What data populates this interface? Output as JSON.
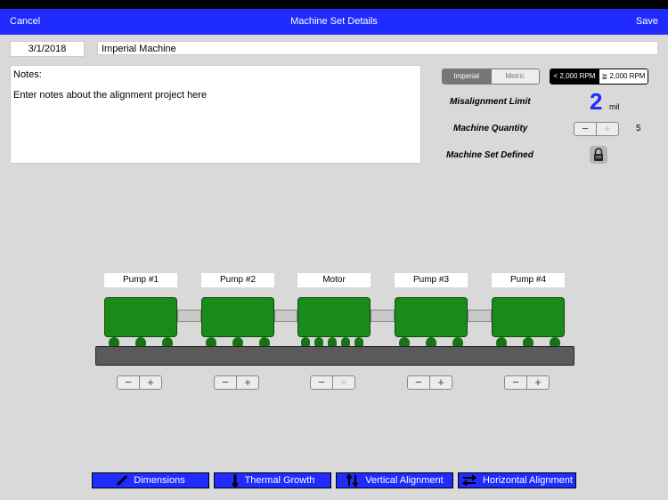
{
  "nav": {
    "cancel": "Cancel",
    "title": "Machine Set Details",
    "save": "Save"
  },
  "form": {
    "date": "3/1/2018",
    "name": "Imperial Machine",
    "notes_label": "Notes:",
    "notes_text": "Enter notes about the alignment project here"
  },
  "units": {
    "imperial": "Imperial",
    "metric": "Metric",
    "selected": "Imperial"
  },
  "rpm": {
    "low": "< 2,000 RPM",
    "high": "≧ 2,000 RPM",
    "selected": "< 2,000 RPM"
  },
  "settings": {
    "misalignment_label": "Misalignment Limit",
    "misalignment_value": "2",
    "misalignment_unit": "mil",
    "quantity_label": "Machine Quantity",
    "quantity_value": "5",
    "defined_label": "Machine Set Defined"
  },
  "machines": [
    {
      "label": "Pump #1"
    },
    {
      "label": "Pump #2"
    },
    {
      "label": "Motor"
    },
    {
      "label": "Pump #3"
    },
    {
      "label": "Pump #4"
    }
  ],
  "tabs": {
    "dimensions": "Dimensions",
    "thermal": "Thermal Growth",
    "vertical": "Vertical Alignment",
    "horizontal": "Horizontal Alignment"
  },
  "colors": {
    "nav_blue": "#1f2bff",
    "motor_green": "#1a8a1a",
    "value_blue": "#1f2bff"
  }
}
